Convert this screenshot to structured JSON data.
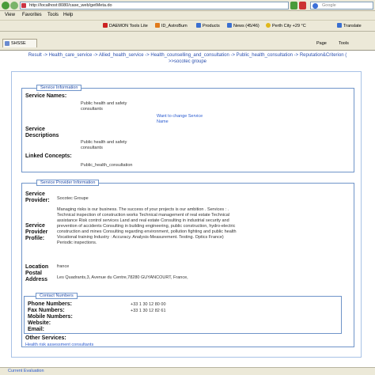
{
  "browser": {
    "url": "http://localhost:8080/case_web/getMeta.do",
    "search_placeholder": "Google",
    "menu": [
      "View",
      "Favorites",
      "Tools",
      "Help"
    ],
    "toolbar": [
      "DAEMON Tools Lite",
      "ID_AstroBum",
      "Products",
      "News (45/46)",
      "Perth City +29 °C",
      "Translate"
    ],
    "tab_title": "SHSSE",
    "tab_tools": [
      "Page",
      "Tools"
    ]
  },
  "breadcrumb": {
    "line1": "Result -> Health_care_service -> Allied_health_service -> Health_counselling_and_consultation -> Public_health_consultation -> Reputation&Criterion (",
    "line2": ">>socotec groupe"
  },
  "service_info": {
    "legend": "Service Information",
    "names_label": "Service Names:",
    "names_value": "Public health and safety consultants",
    "change_link": "Want to change Service Name",
    "descriptions_label": "Service Descriptions",
    "descriptions_value": "Public health and safety consultants",
    "linked_label": "Linked Concepts:",
    "linked_value": "Public_health_consultation"
  },
  "provider_info": {
    "legend": "Service Provider Information",
    "provider_label": "Service Provider:",
    "provider_value": "Socotec Groupe",
    "profile_label": "Service Provider Profile:",
    "profile_value": "Managing risks is our business. The success of your projects is our ambition . Services : . Technical inspection of construction works Technical management of real estate Technical assistance Risk control services Land and real estate Consulting in industrial security and prevention of accidents Consulting in building engineering, public construction, hydro-electric construction and mines Consulting regarding environment, pollution fighting and public health Vocational training Industry : Accuracy. Analysis-Measurement. Testing. Optics France) Periodic inspections.",
    "location_label": "Location",
    "location_value": "france",
    "postal_label": "Postal Address",
    "postal_value": "Les Quadrants,3, Avenue du Centre,78280 GUYANCOURT, France,"
  },
  "contact": {
    "legend": "Contact Numbers",
    "phone_label": "Phone Numbers:",
    "phone_value": "+33 1 30 12 80 00",
    "fax_label": "Fax Numbers:",
    "fax_value": "+33 1 30 12 82 61",
    "mobile_label": "Mobile Numbers:",
    "website_label": "Website:",
    "email_label": "Email:"
  },
  "other": {
    "label": "Other Services:",
    "link": "Health risk assessment consultants"
  },
  "status": {
    "link": "Current Evaluation"
  }
}
